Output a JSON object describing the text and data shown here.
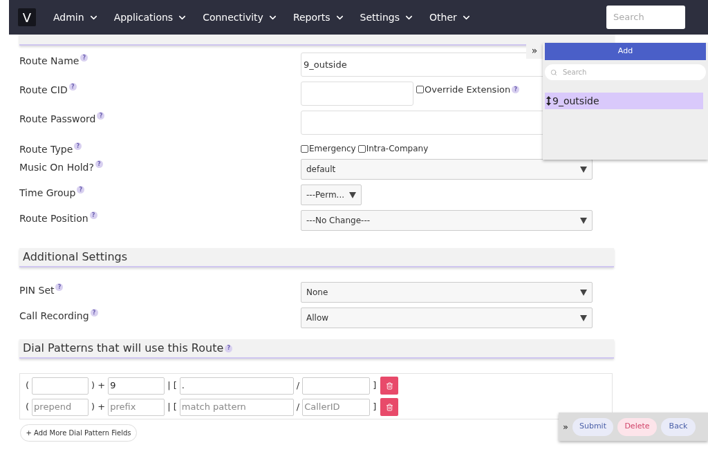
{
  "nav": {
    "logo": "V",
    "menus": [
      {
        "label": "Admin"
      },
      {
        "label": "Applications"
      },
      {
        "label": "Connectivity"
      },
      {
        "label": "Reports"
      },
      {
        "label": "Settings"
      },
      {
        "label": "Other"
      }
    ],
    "search": {
      "placeholder": "Search"
    }
  },
  "general_settings": {
    "fields": [
      {
        "kind": "text",
        "label": "Route Name",
        "help": "?",
        "value": "9_outside"
      },
      {
        "kind": "text_check",
        "label": "Route CID",
        "help": "?",
        "check": {
          "label": "Override Extension",
          "checked": false,
          "help": "?"
        }
      },
      {
        "kind": "password",
        "label": "Route Password",
        "help": "?"
      },
      {
        "kind": "checks",
        "label": "Route Type",
        "help": "?",
        "checks": [
          {
            "label": "Emergency",
            "checked": false
          },
          {
            "label": "Intra-Company",
            "checked": false
          }
        ]
      },
      {
        "kind": "select",
        "label": "Music On Hold?",
        "help": "?",
        "value": "default"
      },
      {
        "kind": "small_select",
        "label": "Time Group",
        "help": "?",
        "value": "---Perm..."
      },
      {
        "kind": "select",
        "label": "Route Position",
        "help": "?",
        "value": "---No Change---"
      }
    ]
  },
  "additional_settings": {
    "title": "Additional Settings",
    "fields": [
      {
        "kind": "select",
        "label": "PIN Set",
        "help": "?",
        "value": "None"
      },
      {
        "kind": "select",
        "label": "Call Recording",
        "help": "?",
        "value": "Allow"
      }
    ]
  },
  "dial_patterns": {
    "title": "Dial Patterns that will use this Route",
    "help": "?",
    "rows": [
      {
        "parts": [
          {
            "kind": "text",
            "text": "("
          },
          {
            "kind": "input"
          },
          {
            "kind": "text",
            "text": ") +"
          },
          {
            "kind": "input",
            "value": "9"
          },
          {
            "kind": "text",
            "text": "| ["
          },
          {
            "kind": "wide_input",
            "value": "."
          },
          {
            "kind": "text",
            "text": "/"
          },
          {
            "kind": "mid_input"
          },
          {
            "kind": "text",
            "text": "]"
          }
        ]
      },
      {
        "parts": [
          {
            "kind": "text",
            "text": "("
          },
          {
            "kind": "input",
            "placeholder": "prepend"
          },
          {
            "kind": "text",
            "text": ") +"
          },
          {
            "kind": "input",
            "placeholder": "prefix"
          },
          {
            "kind": "text",
            "text": "| ["
          },
          {
            "kind": "wide_input",
            "placeholder": "match pattern"
          },
          {
            "kind": "text",
            "text": "/"
          },
          {
            "kind": "mid_input",
            "placeholder": "CallerID"
          },
          {
            "kind": "text",
            "text": "]"
          }
        ]
      }
    ],
    "add_button": "+ Add More Dial Pattern Fields"
  },
  "side_panel": {
    "toggle": "»",
    "add_button": "Add",
    "search": {
      "placeholder": "Search"
    },
    "items": [
      {
        "label": "9_outside",
        "selected": true
      }
    ]
  },
  "action_bar": {
    "toggle": "»",
    "buttons": [
      {
        "label": "Submit",
        "kind": "submit"
      },
      {
        "label": "Delete",
        "kind": "delete"
      },
      {
        "label": "Back",
        "kind": "back"
      }
    ]
  }
}
